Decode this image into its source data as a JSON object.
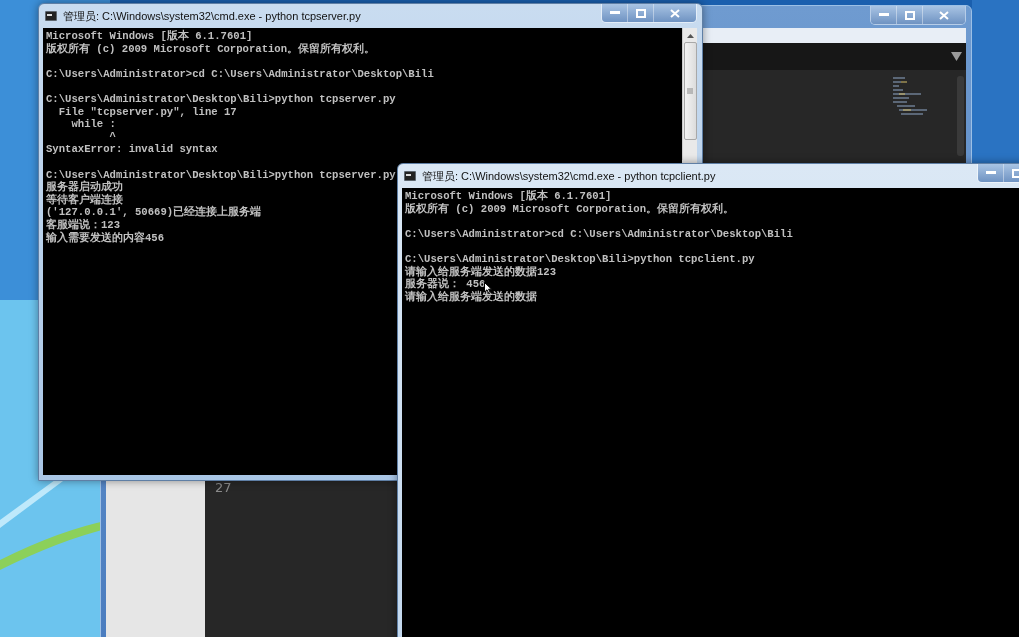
{
  "editor_window": {
    "line_numbers": [
      "27"
    ]
  },
  "server_window": {
    "title": "管理员: C:\\Windows\\system32\\cmd.exe - python  tcpserver.py",
    "output_blocks": [
      [
        "Microsoft Windows [版本 6.1.7601]",
        "版权所有 (c) 2009 Microsoft Corporation。保留所有权利。"
      ],
      [
        "C:\\Users\\Administrator>cd C:\\Users\\Administrator\\Desktop\\Bili"
      ],
      [
        "C:\\Users\\Administrator\\Desktop\\Bili>python tcpserver.py",
        "  File \"tcpserver.py\", line 17",
        "    while :",
        "          ^",
        "SyntaxError: invalid syntax"
      ],
      [
        "C:\\Users\\Administrator\\Desktop\\Bili>python tcpserver.py",
        "服务器启动成功",
        "等待客户端连接",
        "('127.0.0.1', 50669)已经连接上服务端",
        "客服端说：123",
        "输入需要发送的内容456"
      ]
    ]
  },
  "client_window": {
    "title": "管理员: C:\\Windows\\system32\\cmd.exe - python  tcpclient.py",
    "output_blocks": [
      [
        "Microsoft Windows [版本 6.1.7601]",
        "版权所有 (c) 2009 Microsoft Corporation。保留所有权利。"
      ],
      [
        "C:\\Users\\Administrator>cd C:\\Users\\Administrator\\Desktop\\Bili"
      ],
      [
        "C:\\Users\\Administrator\\Desktop\\Bili>python tcpclient.py",
        "请输入给服务端发送的数据123",
        "服务器说： 456",
        "请输入给服务端发送的数据"
      ]
    ]
  }
}
